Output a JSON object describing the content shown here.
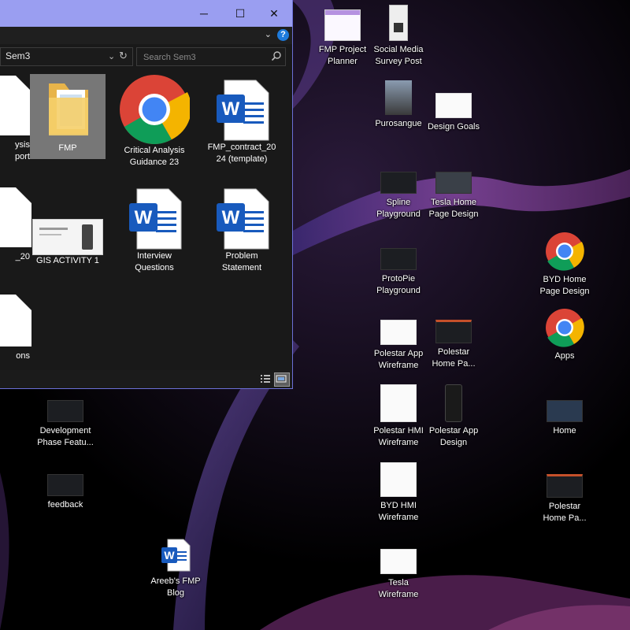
{
  "explorer": {
    "path": "Sem3",
    "search_placeholder": "Search Sem3",
    "buttons": {
      "minimize": "─",
      "maximize": "☐",
      "close": "✕",
      "help": "?"
    },
    "items": [
      {
        "label1": "ysis",
        "label2": "port"
      },
      {
        "label1": "FMP",
        "label2": ""
      },
      {
        "label1": "Critical Analysis",
        "label2": "Guidance 23"
      },
      {
        "label1": "FMP_contract_20",
        "label2": "24 (template)"
      },
      {
        "label1": "_20",
        "label2": ""
      },
      {
        "label1": "GIS ACTIVITY 1",
        "label2": ""
      },
      {
        "label1": "Interview",
        "label2": "Questions"
      },
      {
        "label1": "Problem",
        "label2": "Statement"
      },
      {
        "label1": "ons",
        "label2": ""
      }
    ]
  },
  "desktop": {
    "icons": [
      {
        "l1": "FMP Project",
        "l2": "Planner",
        "icon": "planner-doc-thumb"
      },
      {
        "l1": "Social Media",
        "l2": "Survey Post",
        "icon": "phone-thumb"
      },
      {
        "l1": "Purosangue",
        "l2": "",
        "icon": "photo-thumb"
      },
      {
        "l1": "Design Goals",
        "l2": "",
        "icon": "sketch-thumb"
      },
      {
        "l1": "Spline",
        "l2": "Playground",
        "icon": "dark-thumb"
      },
      {
        "l1": "Tesla Home",
        "l2": "Page Design",
        "icon": "map-thumb"
      },
      {
        "l1": "ProtoPie",
        "l2": "Playground",
        "icon": "dark-thumb"
      },
      {
        "l1": "BYD Home",
        "l2": "Page Design",
        "icon": "chrome-icon"
      },
      {
        "l1": "Polestar App",
        "l2": "Wireframe",
        "icon": "wireframe-thumb"
      },
      {
        "l1": "Polestar",
        "l2": "Home Pa...",
        "icon": "dark-thumb"
      },
      {
        "l1": "Apps",
        "l2": "",
        "icon": "chrome-icon"
      },
      {
        "l1": "Development",
        "l2": "Phase Featu...",
        "icon": "dark-thumb"
      },
      {
        "l1": "Polestar HMI",
        "l2": "Wireframe",
        "icon": "wireframe-thumb"
      },
      {
        "l1": "Polestar App",
        "l2": "Design",
        "icon": "phone-dark-thumb"
      },
      {
        "l1": "Home",
        "l2": "",
        "icon": "map-thumb"
      },
      {
        "l1": "feedback",
        "l2": "",
        "icon": "dark-thumb"
      },
      {
        "l1": "BYD HMI",
        "l2": "Wireframe",
        "icon": "wireframe-thumb"
      },
      {
        "l1": "Polestar",
        "l2": "Home Pa...",
        "icon": "dark-thumb"
      },
      {
        "l1": "Areeb's FMP",
        "l2": "Blog",
        "icon": "word-icon"
      },
      {
        "l1": "Tesla",
        "l2": "Wireframe",
        "icon": "wireframe-thumb"
      }
    ]
  },
  "colors": {
    "titlebar": "#9a9ef1",
    "window_bg": "#191919",
    "word_blue": "#185abd",
    "chrome_red": "#db4437"
  }
}
